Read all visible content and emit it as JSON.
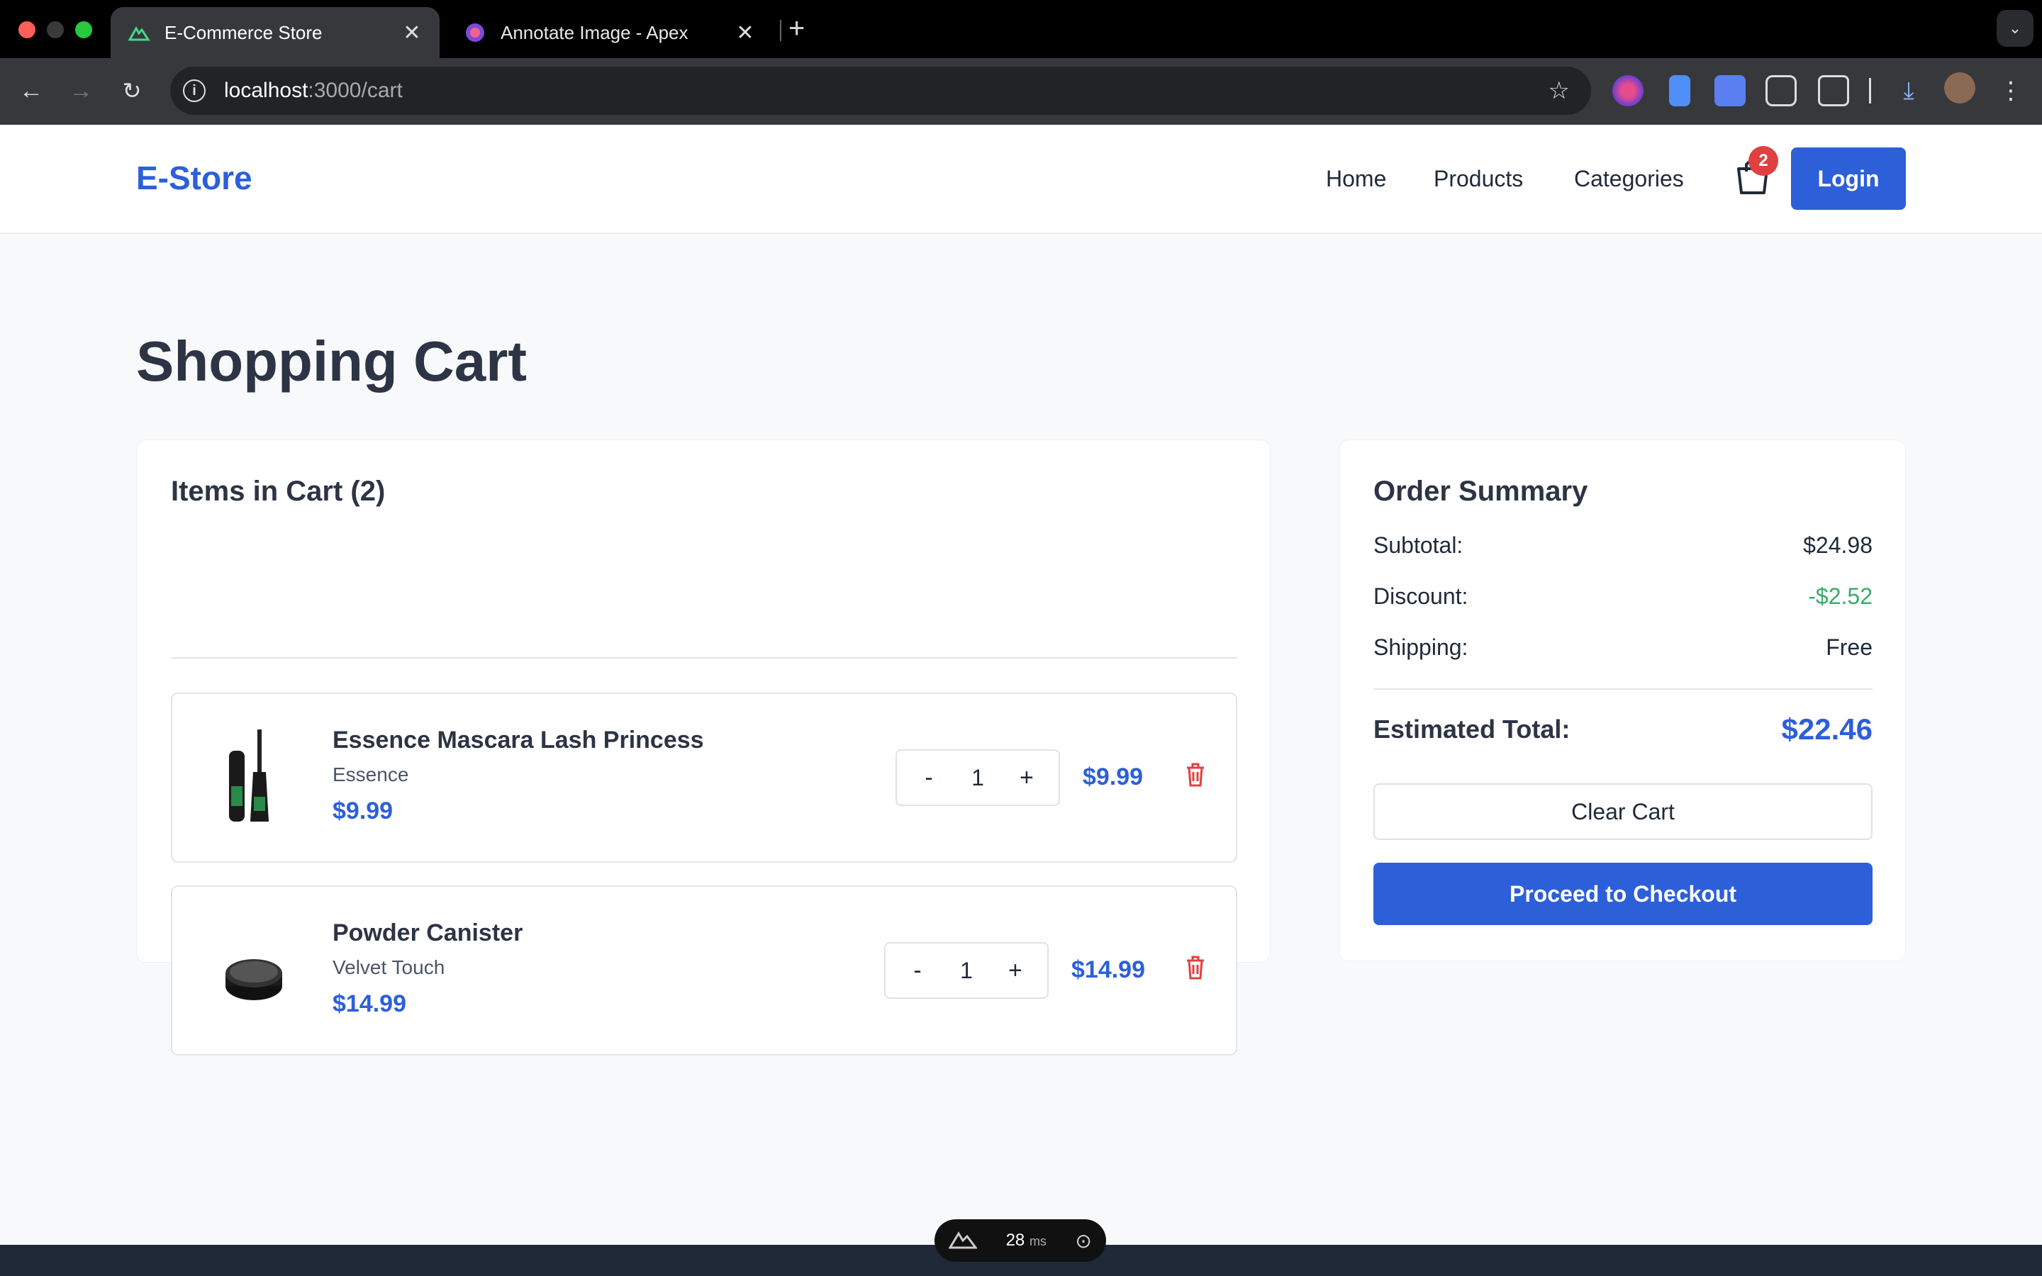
{
  "browser": {
    "tabs": [
      {
        "title": "E-Commerce Store"
      },
      {
        "title": "Annotate Image - Apex"
      }
    ],
    "url_host": "localhost",
    "url_path": ":3000/cart"
  },
  "header": {
    "logo": "E-Store",
    "nav": [
      "Home",
      "Products",
      "Categories"
    ],
    "cart_count": "2",
    "login": "Login"
  },
  "page_title": "Shopping Cart",
  "cart": {
    "heading": "Items in Cart (2)",
    "items": [
      {
        "name": "Essence Mascara Lash Princess",
        "brand": "Essence",
        "price": "$9.99",
        "qty": "1",
        "total": "$9.99"
      },
      {
        "name": "Powder Canister",
        "brand": "Velvet Touch",
        "price": "$14.99",
        "qty": "1",
        "total": "$14.99"
      }
    ],
    "minus": "-",
    "plus": "+"
  },
  "summary": {
    "title": "Order Summary",
    "subtotal_label": "Subtotal:",
    "subtotal": "$24.98",
    "discount_label": "Discount:",
    "discount": "-$2.52",
    "shipping_label": "Shipping:",
    "shipping": "Free",
    "total_label": "Estimated Total:",
    "total": "$22.46",
    "clear": "Clear Cart",
    "checkout": "Proceed to Checkout"
  },
  "devtools": {
    "time": "28",
    "unit": "ms"
  },
  "colors": {
    "primary": "#2d5fd9",
    "discount": "#3aaa6a",
    "badge": "#e04040",
    "trash": "#e04040"
  }
}
